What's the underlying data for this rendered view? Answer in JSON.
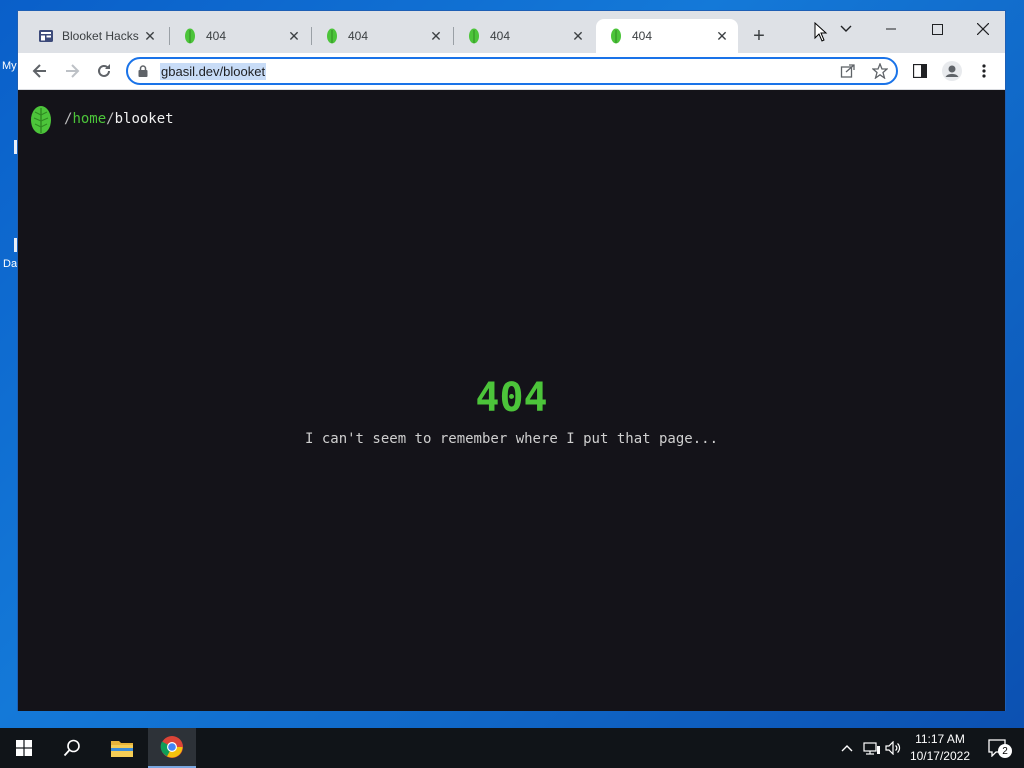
{
  "desktop": {
    "fragments": [
      "My",
      "Da"
    ]
  },
  "browser": {
    "tabs": [
      {
        "title": "Blooket Hacks",
        "icon": "blooket-page-icon",
        "active": false
      },
      {
        "title": "404",
        "icon": "leaf-icon",
        "active": false
      },
      {
        "title": "404",
        "icon": "leaf-icon",
        "active": false
      },
      {
        "title": "404",
        "icon": "leaf-icon",
        "active": false
      },
      {
        "title": "404",
        "icon": "leaf-icon",
        "active": true
      }
    ],
    "url": "gbasil.dev/blooket"
  },
  "page": {
    "breadcrumb": {
      "sep1": "/",
      "home": "home",
      "sep2": "/",
      "current": "blooket"
    },
    "error_code": "404",
    "error_message": "I can't seem to remember where I put that page..."
  },
  "taskbar": {
    "time": "11:17 AM",
    "date": "10/17/2022",
    "notification_count": "2"
  },
  "colors": {
    "accent_green": "#4cc43a",
    "page_bg": "#141319",
    "omnibox_focus": "#1a73e8"
  }
}
